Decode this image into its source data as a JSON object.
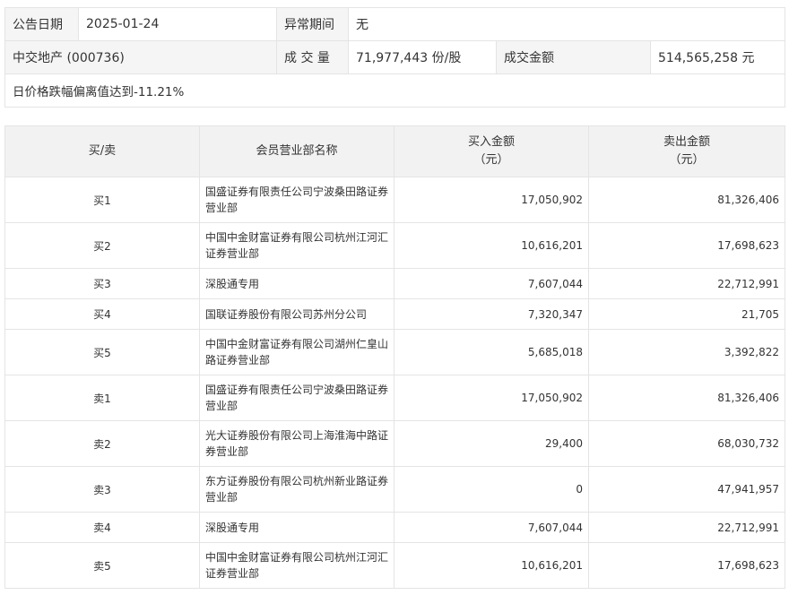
{
  "info": {
    "date_label": "公告日期",
    "date_value": "2025-01-24",
    "period_label": "异常期间",
    "period_value": "无",
    "stock_name": "中交地产 (000736)",
    "volume_label": "成 交 量",
    "volume_value": "71,977,443 份/股",
    "amount_label": "成交金额",
    "amount_value": "514,565,258 元",
    "note": "日价格跌幅偏离值达到-11.21%"
  },
  "table": {
    "headers": {
      "side": "买/卖",
      "member": "会员营业部名称",
      "buy_line1": "买入金额",
      "buy_line2": "（元）",
      "sell_line1": "卖出金额",
      "sell_line2": "（元）"
    },
    "rows": [
      {
        "side": "买1",
        "member": "国盛证券有限责任公司宁波桑田路证券营业部",
        "buy": "17,050,902",
        "sell": "81,326,406"
      },
      {
        "side": "买2",
        "member": "中国中金财富证券有限公司杭州江河汇证券营业部",
        "buy": "10,616,201",
        "sell": "17,698,623"
      },
      {
        "side": "买3",
        "member": "深股通专用",
        "buy": "7,607,044",
        "sell": "22,712,991"
      },
      {
        "side": "买4",
        "member": "国联证券股份有限公司苏州分公司",
        "buy": "7,320,347",
        "sell": "21,705"
      },
      {
        "side": "买5",
        "member": "中国中金财富证券有限公司湖州仁皇山路证券营业部",
        "buy": "5,685,018",
        "sell": "3,392,822"
      },
      {
        "side": "卖1",
        "member": "国盛证券有限责任公司宁波桑田路证券营业部",
        "buy": "17,050,902",
        "sell": "81,326,406"
      },
      {
        "side": "卖2",
        "member": "光大证券股份有限公司上海淮海中路证券营业部",
        "buy": "29,400",
        "sell": "68,030,732"
      },
      {
        "side": "卖3",
        "member": "东方证券股份有限公司杭州新业路证券营业部",
        "buy": "0",
        "sell": "47,941,957"
      },
      {
        "side": "卖4",
        "member": "深股通专用",
        "buy": "7,607,044",
        "sell": "22,712,991"
      },
      {
        "side": "卖5",
        "member": "中国中金财富证券有限公司杭州江河汇证券营业部",
        "buy": "10,616,201",
        "sell": "17,698,623"
      }
    ]
  }
}
